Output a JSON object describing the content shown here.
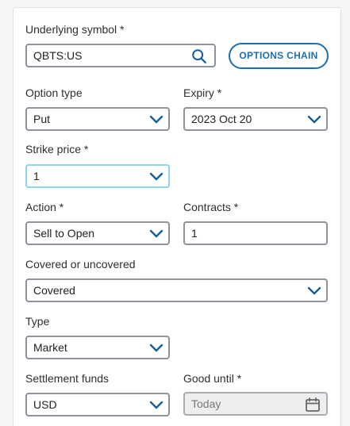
{
  "underlying": {
    "label": "Underlying symbol *",
    "value": "QBTS:US",
    "search_icon": "search-icon",
    "options_chain_label": "OPTIONS CHAIN"
  },
  "option_type": {
    "label": "Option type",
    "value": "Put"
  },
  "expiry": {
    "label": "Expiry *",
    "value": "2023 Oct 20"
  },
  "strike": {
    "label": "Strike price *",
    "value": "1"
  },
  "action": {
    "label": "Action *",
    "value": "Sell to Open"
  },
  "contracts": {
    "label": "Contracts *",
    "value": "1"
  },
  "covered": {
    "label": "Covered or uncovered",
    "value": "Covered"
  },
  "type": {
    "label": "Type",
    "value": "Market"
  },
  "settlement": {
    "label": "Settlement funds",
    "value": "USD"
  },
  "good_until": {
    "label": "Good until *",
    "placeholder": "Today",
    "icon": "calendar-icon"
  },
  "colors": {
    "accent": "#1a6fb3",
    "chevron": "#1a5d9a",
    "focus_border": "#8fd3ec",
    "field_border": "#8e949b"
  }
}
